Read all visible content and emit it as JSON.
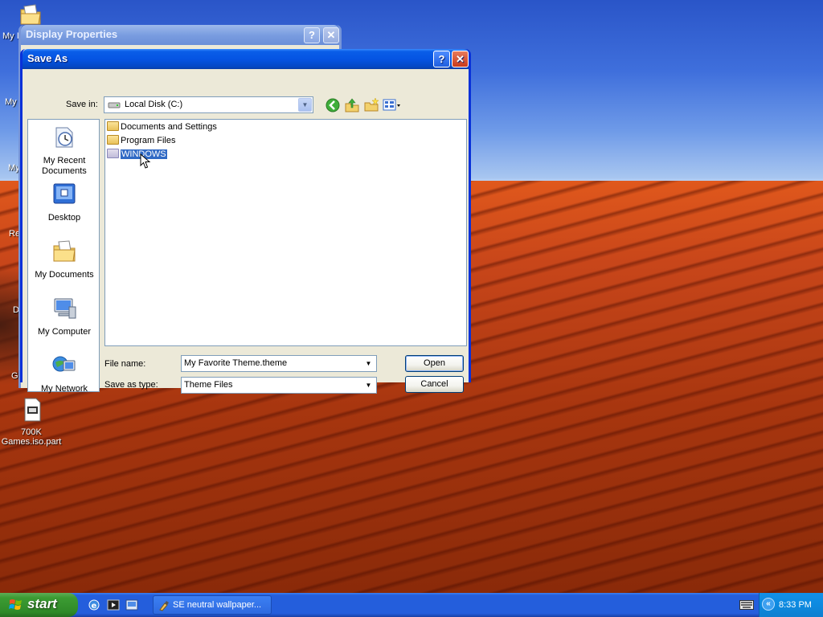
{
  "desktop": {
    "icons": [
      {
        "label": "My Documents (partial)",
        "text": "My I"
      },
      {
        "label": "partial",
        "text": "My"
      },
      {
        "label": "partial",
        "text": "My"
      },
      {
        "label": "partial",
        "text": "Re"
      },
      {
        "label": "partial",
        "text": "D"
      },
      {
        "label": "partial",
        "text": "G"
      }
    ],
    "iso_file_label_line1": "700K",
    "iso_file_label_line2": "Games.iso.part"
  },
  "display_properties": {
    "title": "Display Properties",
    "help_glyph": "?",
    "close_glyph": "✕"
  },
  "save_as": {
    "title": "Save As",
    "help_glyph": "?",
    "close_glyph": "✕",
    "save_in_label": "Save in:",
    "save_in_value": "Local Disk (C:)",
    "places": [
      {
        "line1": "My Recent",
        "line2": "Documents"
      },
      {
        "line1": "Desktop",
        "line2": ""
      },
      {
        "line1": "My Documents",
        "line2": ""
      },
      {
        "line1": "My Computer",
        "line2": ""
      },
      {
        "line1": "My Network",
        "line2": ""
      }
    ],
    "files": [
      {
        "name": "Documents and Settings"
      },
      {
        "name": "Program Files"
      },
      {
        "name": "WINDOWS"
      }
    ],
    "file_name_label": "File name:",
    "file_name_value": "My Favorite Theme.theme",
    "save_as_type_label": "Save as type:",
    "save_as_type_value": "Theme Files",
    "open_label": "Open",
    "cancel_label": "Cancel"
  },
  "taskbar": {
    "start_label": "start",
    "task_label": "SE neutral wallpaper...",
    "clock": "8:33 PM",
    "tray_toggle": "«"
  },
  "colors": {
    "title_blue": "#0554e3",
    "selection": "#316ac5",
    "start_green": "#3c9c33",
    "dialog_bg": "#ece9d8"
  }
}
